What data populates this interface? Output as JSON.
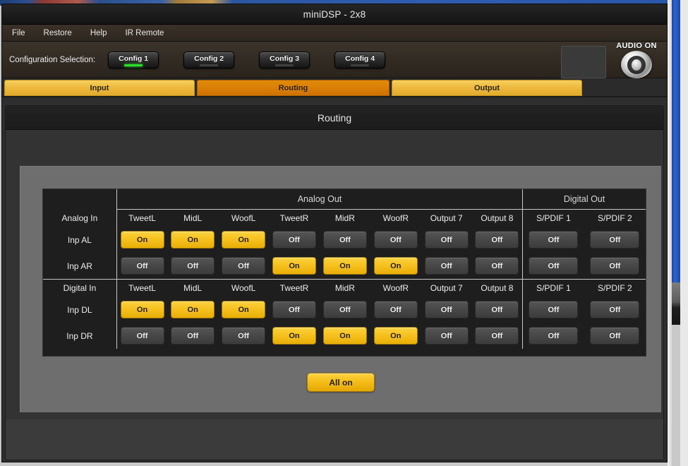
{
  "window": {
    "title": "miniDSP - 2x8"
  },
  "menubar": {
    "items": [
      {
        "label": "File"
      },
      {
        "label": "Restore"
      },
      {
        "label": "Help"
      },
      {
        "label": "IR Remote"
      }
    ]
  },
  "config_bar": {
    "label": "Configuration Selection:",
    "buttons": [
      {
        "label": "Config 1",
        "active": true
      },
      {
        "label": "Config 2",
        "active": false
      },
      {
        "label": "Config 3",
        "active": false
      },
      {
        "label": "Config 4",
        "active": false
      }
    ],
    "audio_status": "AUDIO ON"
  },
  "tabs": [
    {
      "label": "Input",
      "active": false
    },
    {
      "label": "Routing",
      "active": true
    },
    {
      "label": "Output",
      "active": false
    }
  ],
  "page": {
    "title": "Routing"
  },
  "matrix": {
    "group_headers": {
      "analog_out": "Analog Out",
      "digital_out": "Digital Out"
    },
    "analog_section": {
      "input_header": "Analog In",
      "columns": [
        "TweetL",
        "MidL",
        "WoofL",
        "TweetR",
        "MidR",
        "WoofR",
        "Output 7",
        "Output 8"
      ],
      "digital_columns": [
        "S/PDIF 1",
        "S/PDIF 2"
      ],
      "rows": [
        {
          "label": "Inp AL",
          "analog": [
            "On",
            "On",
            "On",
            "Off",
            "Off",
            "Off",
            "Off",
            "Off"
          ],
          "digital": [
            "Off",
            "Off"
          ]
        },
        {
          "label": "Inp AR",
          "analog": [
            "Off",
            "Off",
            "Off",
            "On",
            "On",
            "On",
            "Off",
            "Off"
          ],
          "digital": [
            "Off",
            "Off"
          ]
        }
      ]
    },
    "digital_section": {
      "input_header": "Digital In",
      "columns": [
        "TweetL",
        "MidL",
        "WoofL",
        "TweetR",
        "MidR",
        "WoofR",
        "Output 7",
        "Output 8"
      ],
      "digital_columns": [
        "S/PDIF 1",
        "S/PDIF 2"
      ],
      "rows": [
        {
          "label": "Inp DL",
          "analog": [
            "On",
            "On",
            "On",
            "Off",
            "Off",
            "Off",
            "Off",
            "Off"
          ],
          "digital": [
            "Off",
            "Off"
          ]
        },
        {
          "label": "Inp DR",
          "analog": [
            "Off",
            "Off",
            "Off",
            "On",
            "On",
            "On",
            "Off",
            "Off"
          ],
          "digital": [
            "Off",
            "Off"
          ]
        }
      ]
    }
  },
  "actions": {
    "all_on": "All on"
  },
  "colors": {
    "accent_on": "#f5c01d",
    "tab_active": "#d97f06",
    "tab_inactive": "#edb93c",
    "led_active": "#2ee02e"
  }
}
